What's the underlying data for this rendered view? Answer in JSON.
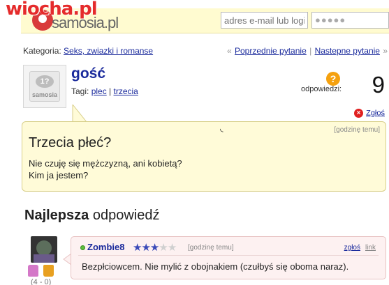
{
  "header": {
    "watermark": "wiocha.pl",
    "logo_main": "samosia",
    "logo_tld": ".pl",
    "email_placeholder": "adres e-mail lub login",
    "password_value": "●●●●●"
  },
  "category": {
    "label": "Kategoria: ",
    "link": "Seks, zwiazki i romanse"
  },
  "nav": {
    "prev_arrow": "«",
    "prev": "Poprzednie pytanie",
    "separator": "|",
    "next": "Nastepne pytanie",
    "next_arrow": "»"
  },
  "question": {
    "avatar_caption": "samosia",
    "avatar_bubble": "1?",
    "author": "gość",
    "tags_label": "Tagi: ",
    "tags": [
      "plec",
      "trzecia"
    ],
    "tag_separator": "|",
    "answers_icon": "?",
    "answers_label": "odpowiedzi:",
    "answers_count": "9",
    "report_label": "Zgłoś",
    "time": "[godzinę temu]",
    "title": "Trzecia płeć?",
    "body_line1": "Nie czuję się mężczyzną, ani kobietą?",
    "body_line2": "Kim ja jestem?"
  },
  "best_answer": {
    "heading_bold": "Najlepsza",
    "heading_rest": " odpowiedź",
    "user": "Zombie8",
    "stars_total": 5,
    "stars_filled": 3,
    "time": "[godzinę temu]",
    "report": "zgłoś",
    "link": "link",
    "text": "Bezpłciowcem. Nie mylić z obojnakiem (czułbyś się oboma naraz).",
    "score": "(4 - 0)"
  },
  "colors": {
    "link": "#1a2a9c",
    "question_bg": "#fffbd8",
    "answer_bg": "#fdf1f1",
    "accent_orange": "#f5a10f",
    "report_red": "#e02020"
  },
  "icons": {
    "report": "close-circle-icon",
    "answers": "question-icon",
    "vote_up": "thumbs-up-icon",
    "vote_down": "thumbs-down-icon",
    "online": "online-dot-icon"
  }
}
